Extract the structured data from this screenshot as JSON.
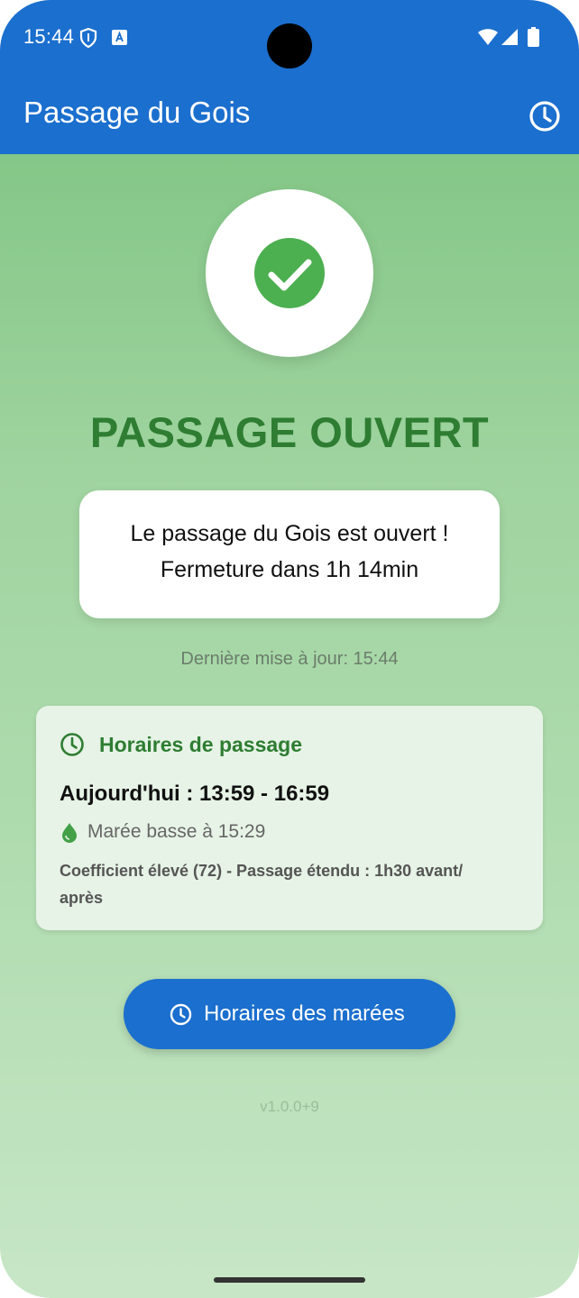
{
  "status_bar": {
    "time": "15:44"
  },
  "app_bar": {
    "title": "Passage du Gois"
  },
  "status": {
    "title": "PASSAGE OUVERT",
    "message_line1": "Le passage du Gois est ouvert !",
    "message_line2": "Fermeture dans 1h 14min",
    "last_update": "Dernière mise à jour: 15:44"
  },
  "schedule": {
    "title": "Horaires de passage",
    "today": "Aujourd'hui : 13:59 - 16:59",
    "low_tide": "Marée basse à 15:29",
    "coefficient_line1": "Coefficient élevé (72) - Passage étendu : 1h30 avant/",
    "coefficient_line2": "après"
  },
  "tide_button": {
    "label": "Horaires des marées"
  },
  "version": "v1.0.0+9",
  "colors": {
    "primary": "#1b6fce",
    "success": "#2e7d32",
    "check_green": "#4caf50",
    "background_top": "#84c787",
    "background_bottom": "#c7e6c6"
  }
}
